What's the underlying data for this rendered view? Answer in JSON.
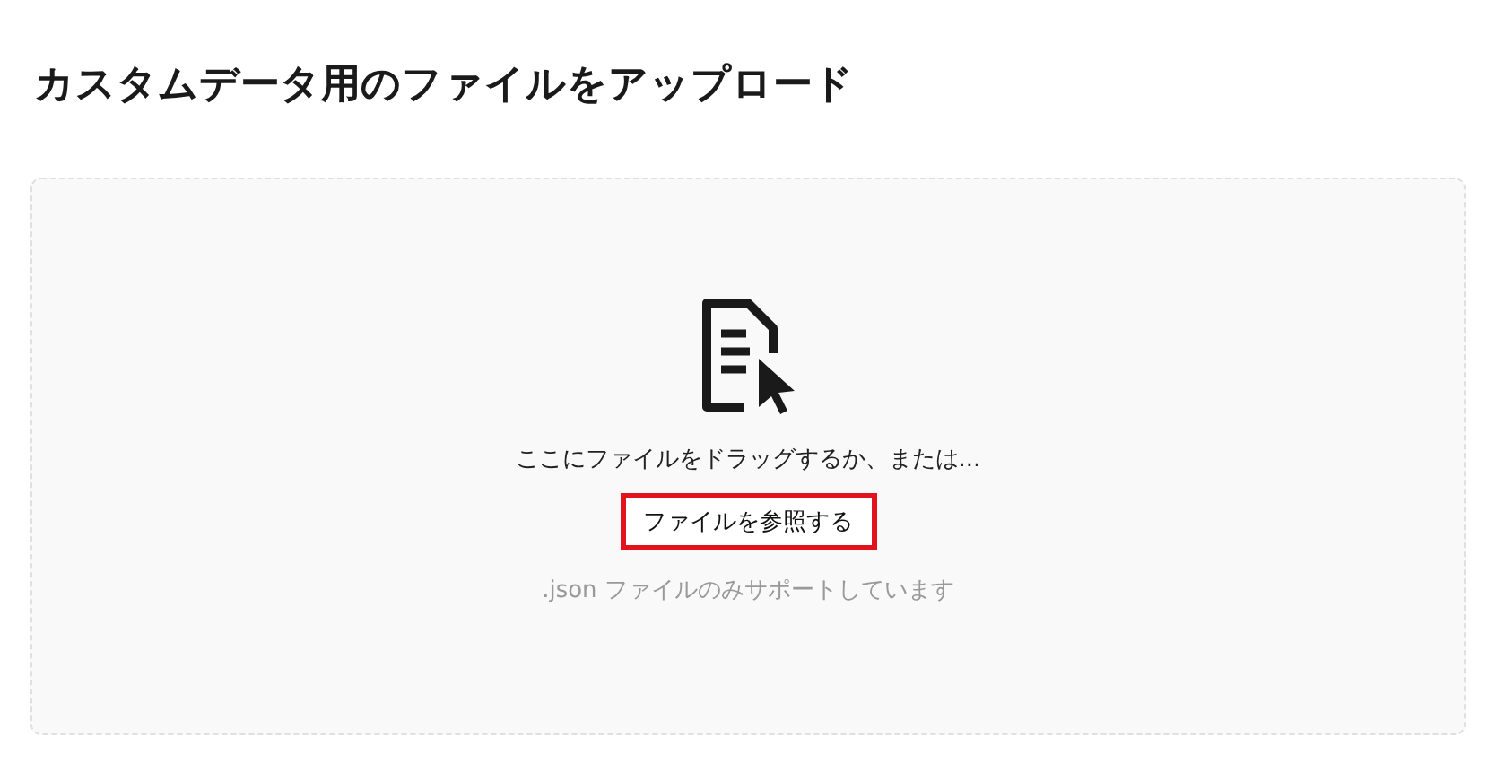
{
  "title": "カスタムデータ用のファイルをアップロード",
  "dropzone": {
    "prompt": "ここにファイルをドラッグするか、または...",
    "button": {
      "label": "ファイルを参照する",
      "highlighted": true
    },
    "hint": ".json ファイルのみサポートしています"
  }
}
